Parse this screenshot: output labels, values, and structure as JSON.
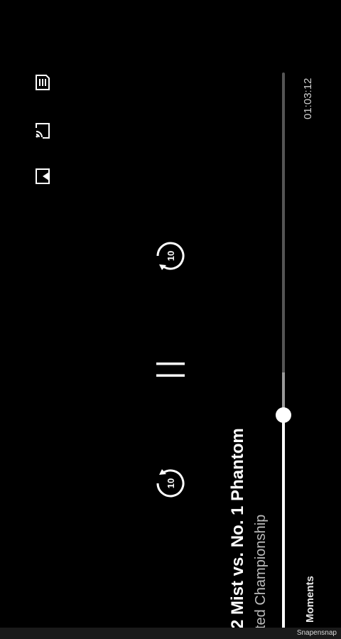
{
  "player": {
    "title_main": "2 Mist vs. No. 1 Phantom",
    "title_sub": "ted Championship",
    "time_elapsed": "01:03:12",
    "moments_label": "Moments",
    "progress_fraction": 0.36,
    "buffered_fraction": 0.44
  },
  "icons": {
    "queue": "playlist-icon",
    "cast": "cast-icon",
    "pip": "picture-in-picture-icon",
    "rewind": "replay-10-icon",
    "pause": "pause-icon",
    "forward": "forward-10-icon",
    "rewind_label": "10",
    "forward_label": "10"
  },
  "watermark": "Snapensnap",
  "colors": {
    "background": "#000000",
    "foreground": "#ffffff",
    "track": "#555555"
  }
}
